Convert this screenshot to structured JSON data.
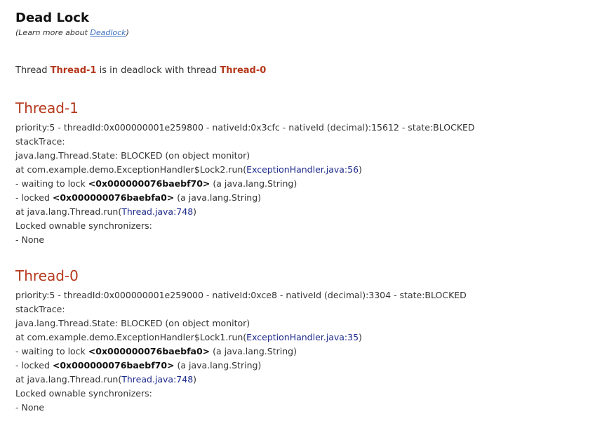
{
  "page": {
    "title": "Dead Lock",
    "learn_more_prefix": "(Learn more about ",
    "learn_more_link": "Deadlock",
    "learn_more_suffix": ")"
  },
  "summary": {
    "prefix": "Thread ",
    "thread_a": "Thread-1",
    "middle": " is in deadlock with thread ",
    "thread_b": "Thread-0"
  },
  "threads": [
    {
      "name": "Thread-1",
      "info": "priority:5 - threadId:0x000000001e259800 - nativeId:0x3cfc - nativeId (decimal):15612 - state:BLOCKED",
      "stack_label": "stackTrace:",
      "state_line": "java.lang.Thread.State: BLOCKED (on object monitor)",
      "frame1_prefix": "at com.example.demo.ExceptionHandler$Lock2.run(",
      "frame1_link": "ExceptionHandler.java:56",
      "frame1_suffix": ")",
      "waiting_prefix": "- waiting to lock ",
      "waiting_addr": "<0x000000076baebf70>",
      "waiting_suffix": " (a java.lang.String)",
      "locked_prefix": "- locked ",
      "locked_addr": "<0x000000076baebfa0>",
      "locked_suffix": " (a java.lang.String)",
      "frame2_prefix": "at java.lang.Thread.run(",
      "frame2_link": "Thread.java:748",
      "frame2_suffix": ")",
      "sync_label": "Locked ownable synchronizers:",
      "sync_value": "- None"
    },
    {
      "name": "Thread-0",
      "info": "priority:5 - threadId:0x000000001e259000 - nativeId:0xce8 - nativeId (decimal):3304 - state:BLOCKED",
      "stack_label": "stackTrace:",
      "state_line": "java.lang.Thread.State: BLOCKED (on object monitor)",
      "frame1_prefix": "at com.example.demo.ExceptionHandler$Lock1.run(",
      "frame1_link": "ExceptionHandler.java:35",
      "frame1_suffix": ")",
      "waiting_prefix": "- waiting to lock ",
      "waiting_addr": "<0x000000076baebfa0>",
      "waiting_suffix": " (a java.lang.String)",
      "locked_prefix": "- locked ",
      "locked_addr": "<0x000000076baebf70>",
      "locked_suffix": " (a java.lang.String)",
      "frame2_prefix": "at java.lang.Thread.run(",
      "frame2_link": "Thread.java:748",
      "frame2_suffix": ")",
      "sync_label": "Locked ownable synchronizers:",
      "sync_value": "- None"
    }
  ],
  "colors": {
    "heading": "#b5381c",
    "link": "#1d2a8a",
    "learn_more_link": "#3a6fc2",
    "text": "#333333"
  }
}
